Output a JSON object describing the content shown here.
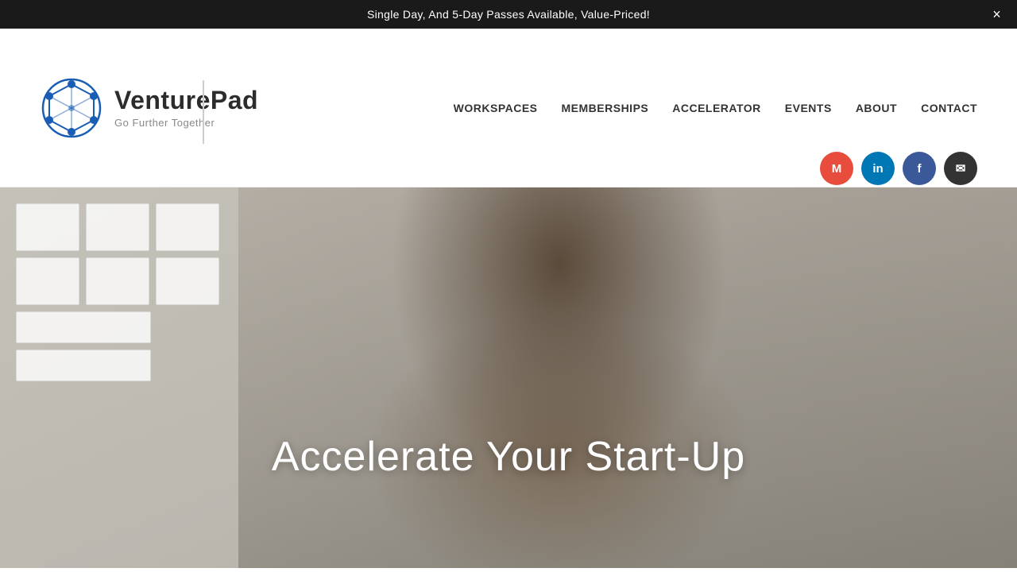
{
  "announcement": {
    "text": "Single Day,  And 5-Day Passes Available, Value-Priced!",
    "close_label": "×"
  },
  "logo": {
    "brand_first": "Venture",
    "brand_bold": "Pad",
    "tagline": "Go Further Together"
  },
  "nav": {
    "items": [
      {
        "label": "WORKSPACES",
        "id": "nav-workspaces"
      },
      {
        "label": "MEMBERSHIPS",
        "id": "nav-memberships"
      },
      {
        "label": "ACCELERATOR",
        "id": "nav-accelerator"
      },
      {
        "label": "EVENTS",
        "id": "nav-events"
      },
      {
        "label": "ABOUT",
        "id": "nav-about"
      },
      {
        "label": "CONTACT",
        "id": "nav-contact"
      }
    ]
  },
  "social": {
    "medium_label": "M",
    "linkedin_label": "in",
    "facebook_label": "f",
    "email_label": "✉"
  },
  "hero": {
    "headline": "Accelerate Your Start-Up"
  }
}
